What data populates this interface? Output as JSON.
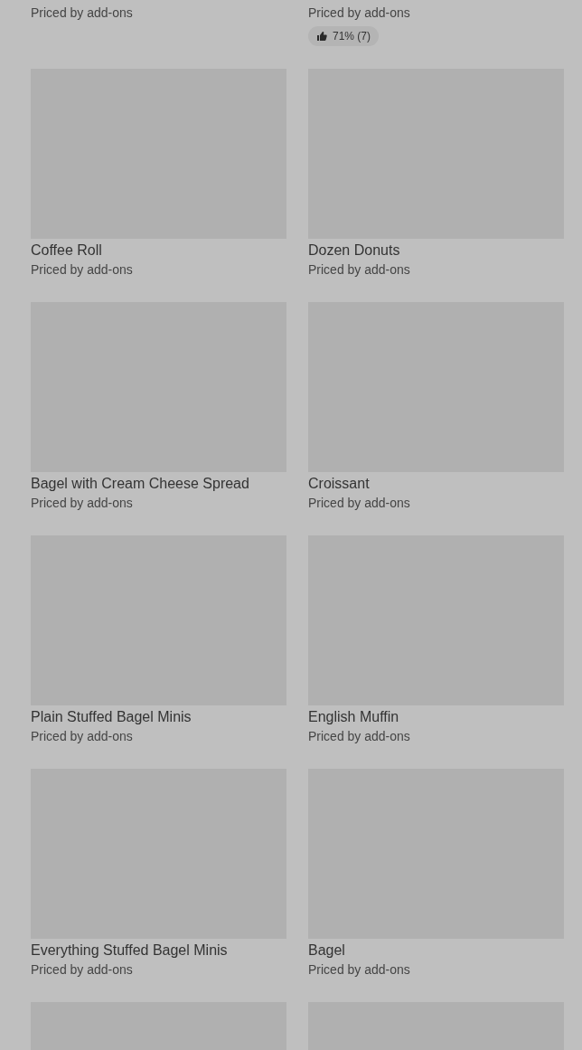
{
  "top_row": [
    {
      "price": "Priced by add-ons"
    },
    {
      "price": "Priced by add-ons",
      "rating": "71% (7)"
    }
  ],
  "products": [
    {
      "name": "Coffee Roll",
      "price": "Priced by add-ons"
    },
    {
      "name": "Dozen Donuts",
      "price": "Priced by add-ons"
    },
    {
      "name": "Bagel with Cream Cheese Spread",
      "price": "Priced by add-ons"
    },
    {
      "name": "Croissant",
      "price": "Priced by add-ons"
    },
    {
      "name": "Plain Stuffed Bagel Minis",
      "price": "Priced by add-ons"
    },
    {
      "name": "English Muffin",
      "price": "Priced by add-ons"
    },
    {
      "name": "Everything Stuffed Bagel Minis",
      "price": "Priced by add-ons"
    },
    {
      "name": "Bagel",
      "price": "Priced by add-ons"
    }
  ]
}
